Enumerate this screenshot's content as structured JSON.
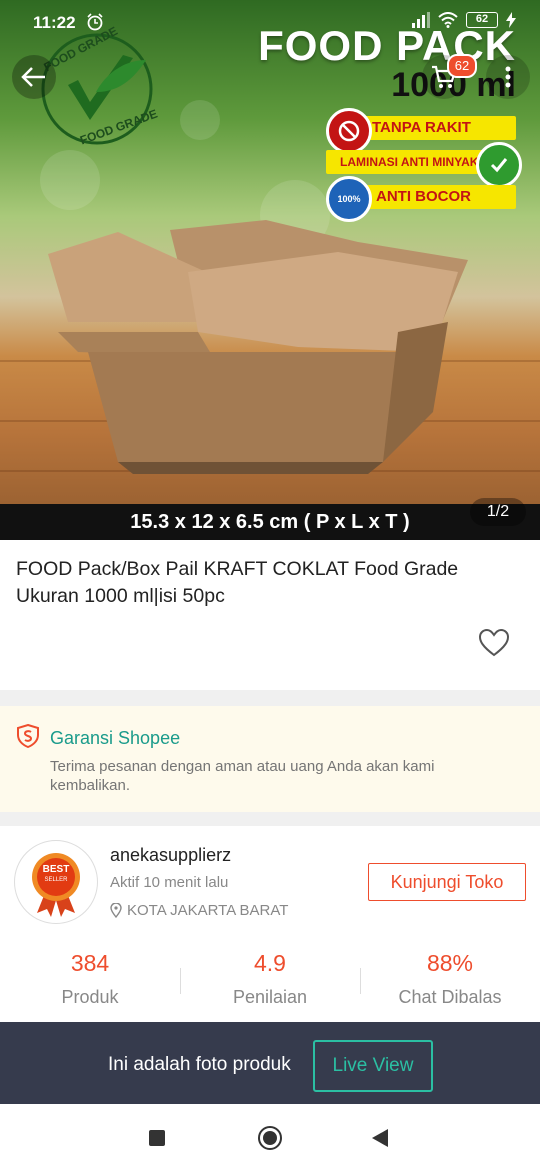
{
  "status_bar": {
    "time": "11:22",
    "battery": "62"
  },
  "hero": {
    "cart_count": "62",
    "badge_text_top": "FOOD GRADE",
    "badge_text_bottom": "FOOD GRADE",
    "title": "FOOD PACK",
    "volume": "1000 ml",
    "features": [
      "TANPA RAKIT",
      "LAMINASI ANTI MINYAK",
      "ANTI BOCOR"
    ],
    "anti_bocor_pct": "100%",
    "dimensions": "15.3 x 12 x 6.5 cm ( P x L x T )",
    "page_indicator": "1/2"
  },
  "product": {
    "title": "FOOD Pack/Box Pail KRAFT COKLAT Food Grade Ukuran 1000 ml|isi 50pc"
  },
  "guarantee": {
    "title": "Garansi Shopee",
    "description": "Terima pesanan dengan aman atau uang Anda akan kami kembalikan."
  },
  "shop": {
    "badge_top": "BEST",
    "badge_bottom": "SELLER",
    "name": "anekasupplierz",
    "active": "Aktif 10 menit lalu",
    "location": "KOTA JAKARTA BARAT",
    "visit_label": "Kunjungi Toko",
    "stats": [
      {
        "value": "384",
        "label": "Produk"
      },
      {
        "value": "4.9",
        "label": "Penilaian"
      },
      {
        "value": "88%",
        "label": "Chat Dibalas"
      }
    ]
  },
  "banner": {
    "text": "Ini adalah foto produk",
    "button": "Live View"
  },
  "colors": {
    "accent": "#ee4d2d",
    "teal": "#2bbfa3",
    "banner_bg": "#363b4d"
  }
}
